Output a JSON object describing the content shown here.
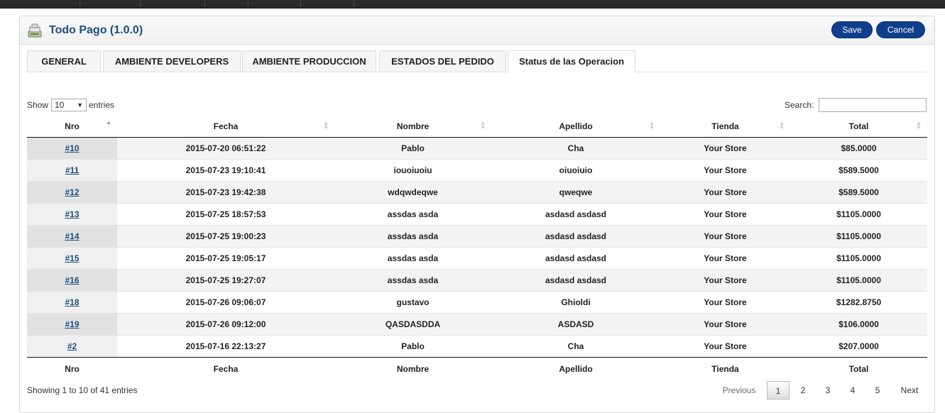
{
  "header": {
    "title": "Todo Pago (1.0.0)",
    "save_label": "Save",
    "cancel_label": "Cancel"
  },
  "tabs": [
    {
      "label": "GENERAL"
    },
    {
      "label": "AMBIENTE DEVELOPERS"
    },
    {
      "label": "AMBIENTE PRODUCCION"
    },
    {
      "label": "ESTADOS DEL PEDIDO"
    },
    {
      "label": "Status de las Operacion"
    }
  ],
  "active_tab": "Status de las Operacion",
  "controls": {
    "show_label": "Show",
    "page_size": "10",
    "entries_label": "entries",
    "search_label": "Search:",
    "search_value": ""
  },
  "columns": [
    "Nro",
    "Fecha",
    "Nombre",
    "Apellido",
    "Tienda",
    "Total"
  ],
  "rows": [
    [
      "#10",
      "2015-07-20 06:51:22",
      "Pablo",
      "Cha",
      "Your Store",
      "$85.0000"
    ],
    [
      "#11",
      "2015-07-23 19:10:41",
      "iouoiuoiu",
      "oiuoiuio",
      "Your Store",
      "$589.5000"
    ],
    [
      "#12",
      "2015-07-23 19:42:38",
      "wdqwdeqwe",
      "qweqwe",
      "Your Store",
      "$589.5000"
    ],
    [
      "#13",
      "2015-07-25 18:57:53",
      "assdas asda",
      "asdasd asdasd",
      "Your Store",
      "$1105.0000"
    ],
    [
      "#14",
      "2015-07-25 19:00:23",
      "assdas asda",
      "asdasd asdasd",
      "Your Store",
      "$1105.0000"
    ],
    [
      "#15",
      "2015-07-25 19:05:17",
      "assdas asda",
      "asdasd asdasd",
      "Your Store",
      "$1105.0000"
    ],
    [
      "#16",
      "2015-07-25 19:27:07",
      "assdas asda",
      "asdasd asdasd",
      "Your Store",
      "$1105.0000"
    ],
    [
      "#18",
      "2015-07-26 09:06:07",
      "gustavo",
      "Ghioldi",
      "Your Store",
      "$1282.8750"
    ],
    [
      "#19",
      "2015-07-26 09:12:00",
      "QASDASDDA",
      "ASDASD",
      "Your Store",
      "$106.0000"
    ],
    [
      "#2",
      "2015-07-16 22:13:27",
      "Pablo",
      "Cha",
      "Your Store",
      "$207.0000"
    ]
  ],
  "footer": {
    "info": "Showing 1 to 10 of 41 entries",
    "previous": "Previous",
    "pages": [
      "1",
      "2",
      "3",
      "4",
      "5"
    ],
    "current_page": "1",
    "next": "Next"
  },
  "colors": {
    "accent": "#0f3f8c",
    "title": "#1e4d80",
    "topbar": "#2a2a2a"
  }
}
